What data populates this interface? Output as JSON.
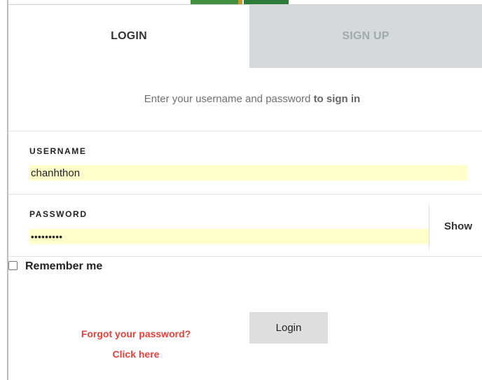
{
  "tabs": {
    "login": "LOGIN",
    "signup": "SIGN UP"
  },
  "instructions": {
    "prefix": "Enter your username and password ",
    "emphasis": "to sign in"
  },
  "username": {
    "label": "USERNAME",
    "value": "chanhthon"
  },
  "password": {
    "label": "PASSWORD",
    "masked_value": "•••••••••",
    "show_label": "Show"
  },
  "remember": {
    "label": "Remember me",
    "checked": false
  },
  "forgot": {
    "line1": "Forgot your password?",
    "line2": "Click here"
  },
  "login_button": "Login",
  "colors": {
    "autofill_bg": "#ffffcc",
    "link_red": "#e8403a",
    "inactive_tab_bg": "#d6d9d9"
  }
}
